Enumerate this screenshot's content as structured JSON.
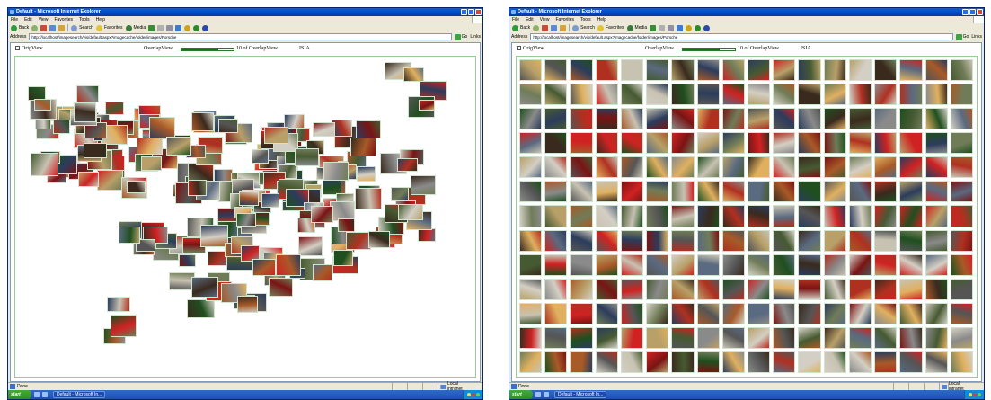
{
  "palette": [
    "#3a2a1e",
    "#7a1414",
    "#c8c2b2",
    "#b8a068",
    "#465a32",
    "#2c3c5c",
    "#d4cfc4",
    "#8a8a8a",
    "#a85a28",
    "#5a6a80",
    "#d02222",
    "#1f4f1f",
    "#e0b060",
    "#555555",
    "#b03020",
    "#707c58"
  ],
  "windows": [
    {
      "id": "left",
      "title": "Default - Microsoft Internet Explorer",
      "menu": [
        "File",
        "Edit",
        "View",
        "Favorites",
        "Tools",
        "Help"
      ],
      "toolbar": {
        "back": "Back",
        "search": "Search",
        "favorites": "Favorites",
        "media": "Media"
      },
      "address_label": "Address",
      "address_url": "http://localhost/imagesearch/vis/default.aspx?imagecache/folder/images/Porsche",
      "go_label": "Go",
      "links_label": "Links",
      "controls": {
        "orig_view": "OrigView",
        "overlap_view": "OverlapView",
        "slider_value": 0.7,
        "slider_label": "10 of OverlapView",
        "mode": "ISIA"
      },
      "layout": "scatter",
      "status": "Done",
      "zone": "Local intranet",
      "start": "start",
      "task": "Default - Microsoft In..."
    },
    {
      "id": "right",
      "title": "Default - Microsoft Internet Explorer",
      "menu": [
        "File",
        "Edit",
        "View",
        "Favorites",
        "Tools",
        "Help"
      ],
      "toolbar": {
        "back": "Back",
        "search": "Search",
        "favorites": "Favorites",
        "media": "Media"
      },
      "address_label": "Address",
      "address_url": "http://localhost/imagesearch/vis/default.aspx?imagecache/folder/images/Porsche",
      "go_label": "Go",
      "links_label": "Links",
      "controls": {
        "orig_view": "OrigView",
        "overlap_view": "OverlapView",
        "slider_value": 0.7,
        "slider_label": "10 of OverlapView",
        "mode": "ISIA"
      },
      "layout": "grid",
      "status": "Done",
      "zone": "Local intranet",
      "start": "start",
      "task": "Default - Microsoft In..."
    }
  ]
}
